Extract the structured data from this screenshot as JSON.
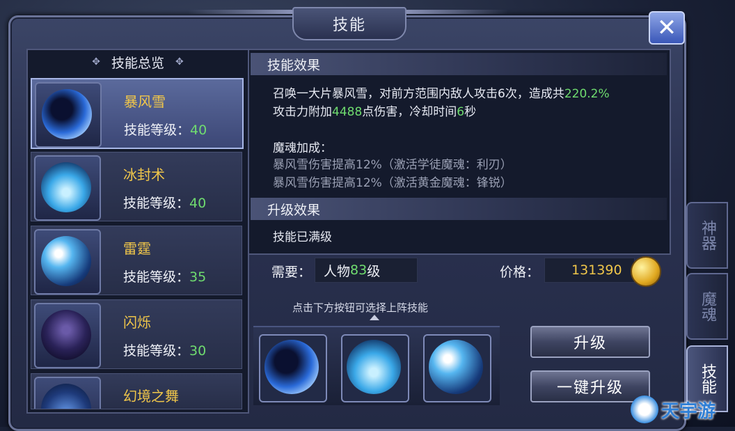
{
  "window": {
    "title": "技能"
  },
  "left_panel": {
    "header": "技能总览",
    "level_label": "技能等级：",
    "skills": [
      {
        "name": "暴风雪",
        "level": "40",
        "active": true
      },
      {
        "name": "冰封术",
        "level": "40",
        "active": false
      },
      {
        "name": "雷霆",
        "level": "35",
        "active": false
      },
      {
        "name": "闪烁",
        "level": "30",
        "active": false
      },
      {
        "name": "幻境之舞",
        "level": "",
        "active": false
      }
    ]
  },
  "effect": {
    "header": "技能效果",
    "line1_a": "召唤一大片暴风雪，对前方范围内敌人攻击6次，造成共",
    "line1_pct": "220.2%",
    "line2_a": "攻击力附加",
    "line2_dmg": "4488",
    "line2_b": "点伤害，冷却时间",
    "line2_cd": "6",
    "line2_c": "秒",
    "soul_title": "魔魂加成：",
    "soul_lines": [
      "暴风雪伤害提高12%（激活学徒魔魂：利刃）",
      "暴风雪伤害提高12%（激活黄金魔魂：锋锐）"
    ]
  },
  "upgrade": {
    "header": "升级效果",
    "text": "技能已满级"
  },
  "requirement": {
    "label": "需要：",
    "value_a": "人物",
    "value_level": "83",
    "value_b": "级"
  },
  "price": {
    "label": "价格：",
    "value": "131390"
  },
  "hint": "点击下方按钮可选择上阵技能",
  "buttons": {
    "upgrade": "升级",
    "upgrade_all": "一键升级"
  },
  "side_tabs": [
    {
      "label": "神器",
      "active": false
    },
    {
      "label": "魔魂",
      "active": false
    },
    {
      "label": "技能",
      "active": true
    }
  ],
  "watermark": "天宇游",
  "colors": {
    "level_green": "#6fdc6f",
    "skill_name_gold": "#f0c64a",
    "price_gold": "#f0c64a"
  },
  "icons": {
    "close": "close-icon",
    "coin": "gold-coin-icon"
  }
}
